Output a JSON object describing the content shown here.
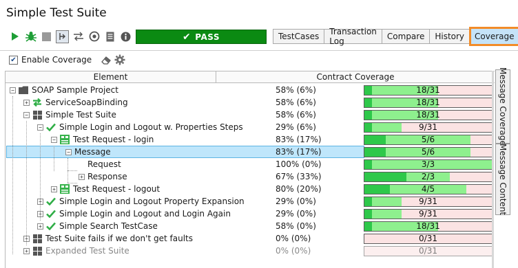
{
  "window": {
    "title": "Simple Test Suite"
  },
  "toolbar": {
    "icons": [
      "run-icon",
      "debug-icon",
      "stop-icon",
      "step-icon",
      "transfer-icon",
      "target-icon",
      "report-icon",
      "info-icon"
    ],
    "status_label": "PASS",
    "status_color": "#0b8a12"
  },
  "tabs": [
    {
      "label": "TestCases",
      "active": false
    },
    {
      "label": "Transaction Log",
      "active": false
    },
    {
      "label": "Compare",
      "active": false
    },
    {
      "label": "History",
      "active": false
    },
    {
      "label": "Coverage",
      "active": true
    }
  ],
  "coverage": {
    "enable_label": "Enable Coverage",
    "enabled": true
  },
  "grid": {
    "columns": [
      "Element",
      "Contract Coverage"
    ],
    "rows": [
      {
        "name": "SOAP Sample Project",
        "icon": "folder-icon",
        "expander": "minus",
        "pct": "58% (6%)",
        "bar": "18/31",
        "fill": 0.58,
        "dark": 0.06
      },
      {
        "name": "ServiceSoapBinding",
        "icon": "binding-icon",
        "expander": "plus",
        "pct": "58% (6%)",
        "bar": "18/31",
        "fill": 0.58,
        "dark": 0.06
      },
      {
        "name": "Simple Test Suite",
        "icon": "suite-icon",
        "expander": "minus",
        "pct": "58% (6%)",
        "bar": "18/31",
        "fill": 0.58,
        "dark": 0.06
      },
      {
        "name": "Simple Login and Logout w. Properties Steps",
        "icon": "check-icon",
        "expander": "minus",
        "pct": "29% (6%)",
        "bar": "9/31",
        "fill": 0.29,
        "dark": 0.06
      },
      {
        "name": "Test Request - login",
        "icon": "request-icon",
        "expander": "minus",
        "pct": "83% (17%)",
        "bar": "5/6",
        "fill": 0.83,
        "dark": 0.17
      },
      {
        "name": "Message",
        "icon": "",
        "expander": "minus",
        "pct": "83% (17%)",
        "bar": "5/6",
        "fill": 0.83,
        "dark": 0.17,
        "selected": true
      },
      {
        "name": "Request",
        "icon": "",
        "expander": "none",
        "pct": "100% (0%)",
        "bar": "3/3",
        "fill": 1.0,
        "dark": 0.0
      },
      {
        "name": "Response",
        "icon": "",
        "expander": "plus",
        "pct": "67% (33%)",
        "bar": "2/3",
        "fill": 0.67,
        "dark": 0.33
      },
      {
        "name": "Test Request - logout",
        "icon": "request-icon",
        "expander": "plus",
        "pct": "80% (20%)",
        "bar": "4/5",
        "fill": 0.8,
        "dark": 0.2
      },
      {
        "name": "Simple Login and Logout Property Expansion",
        "icon": "check-icon",
        "expander": "plus",
        "pct": "29% (0%)",
        "bar": "9/31",
        "fill": 0.29,
        "dark": 0.0
      },
      {
        "name": "Simple Login and Logout and Login Again",
        "icon": "check-icon",
        "expander": "plus",
        "pct": "29% (0%)",
        "bar": "9/31",
        "fill": 0.29,
        "dark": 0.0
      },
      {
        "name": "Simple Search TestCase",
        "icon": "check-icon",
        "expander": "plus",
        "pct": "58% (0%)",
        "bar": "18/31",
        "fill": 0.58,
        "dark": 0.0
      },
      {
        "name": "Test Suite fails if we don't get faults",
        "icon": "suite-icon",
        "expander": "plus",
        "pct": "0% (0%)",
        "bar": "0/31",
        "fill": 0.0,
        "dark": 0.0
      },
      {
        "name": "Expanded Test Suite",
        "icon": "suite-icon",
        "expander": "plus",
        "pct": "0% (0%)",
        "bar": "0/31",
        "fill": 0.0,
        "dark": 0.0,
        "dim": true
      }
    ]
  },
  "side_tabs": [
    "Message Coverage",
    "Message Content"
  ]
}
